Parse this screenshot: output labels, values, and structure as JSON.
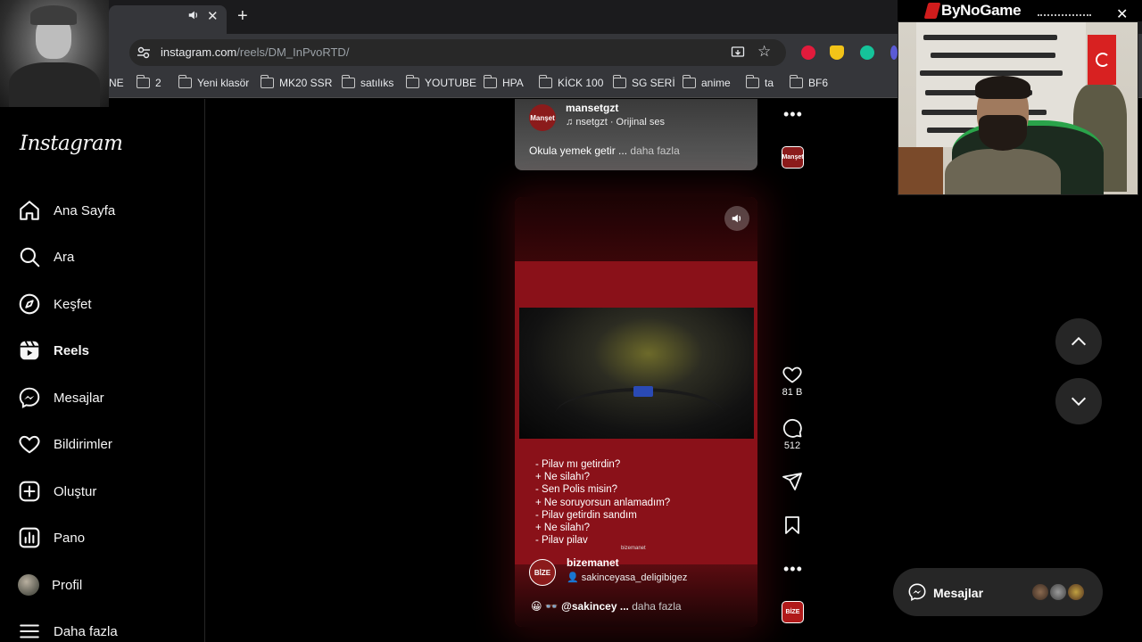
{
  "browser": {
    "url_host": "instagram.com",
    "url_path": "/reels/DM_InPvoRTD/",
    "tab_close": "✕",
    "new_tab": "+",
    "bookmarks": [
      {
        "label": "NE",
        "folder": false
      },
      {
        "label": "2",
        "folder": true
      },
      {
        "label": "Yeni klasör",
        "folder": true
      },
      {
        "label": "MK20 SSR",
        "folder": true
      },
      {
        "label": "satılıks",
        "folder": true
      },
      {
        "label": "YOUTUBE",
        "folder": true
      },
      {
        "label": "HPA",
        "folder": true
      },
      {
        "label": "KİCK 100",
        "folder": true
      },
      {
        "label": "SG SERİ",
        "folder": true
      },
      {
        "label": "anime",
        "folder": true
      },
      {
        "label": "ta",
        "folder": true
      },
      {
        "label": "BF6",
        "folder": true
      }
    ]
  },
  "instagram": {
    "logo": "Instagram",
    "nav": [
      {
        "label": "Ana Sayfa",
        "icon": "home-icon"
      },
      {
        "label": "Ara",
        "icon": "search-icon"
      },
      {
        "label": "Keşfet",
        "icon": "compass-icon"
      },
      {
        "label": "Reels",
        "icon": "reels-icon",
        "active": true
      },
      {
        "label": "Mesajlar",
        "icon": "messenger-icon"
      },
      {
        "label": "Bildirimler",
        "icon": "heart-icon"
      },
      {
        "label": "Oluştur",
        "icon": "plus-square-icon"
      },
      {
        "label": "Pano",
        "icon": "chart-icon"
      },
      {
        "label": "Profil",
        "icon": "avatar"
      },
      {
        "label": "Daha fazla",
        "icon": "menu-icon"
      }
    ]
  },
  "previous_reel": {
    "avatar_text": "Manşet",
    "username": "mansetgzt",
    "audio": "nsetgzt · Orijinal ses",
    "caption": "Okula yemek getir ...",
    "more": "daha fazla"
  },
  "reel": {
    "dialog": [
      "- Pilav mı getirdin?",
      "+ Ne silahı?",
      "- Sen Polis misin?",
      "+ Ne soruyorsun anlamadım?",
      "- Pilav getirdin sandım",
      "+ Ne silahı?",
      "- Pilav pilav"
    ],
    "watermark": "bizemanet",
    "avatar_text": "BİZE",
    "username": "bizemanet",
    "tagged": "sakinceyasa_deligibigez",
    "caption": "@sakincey ...",
    "more": "daha fazla",
    "likes": "81 B",
    "comments": "512",
    "more_dots": "•••"
  },
  "messages_pill": {
    "label": "Mesajlar"
  },
  "stream_overlay": {
    "brand": "ByNoGame",
    "close": "✕"
  },
  "colors": {
    "reel_accent": "#8a1119",
    "brand_red": "#d01c1c",
    "chair_green": "#2aa34a"
  }
}
